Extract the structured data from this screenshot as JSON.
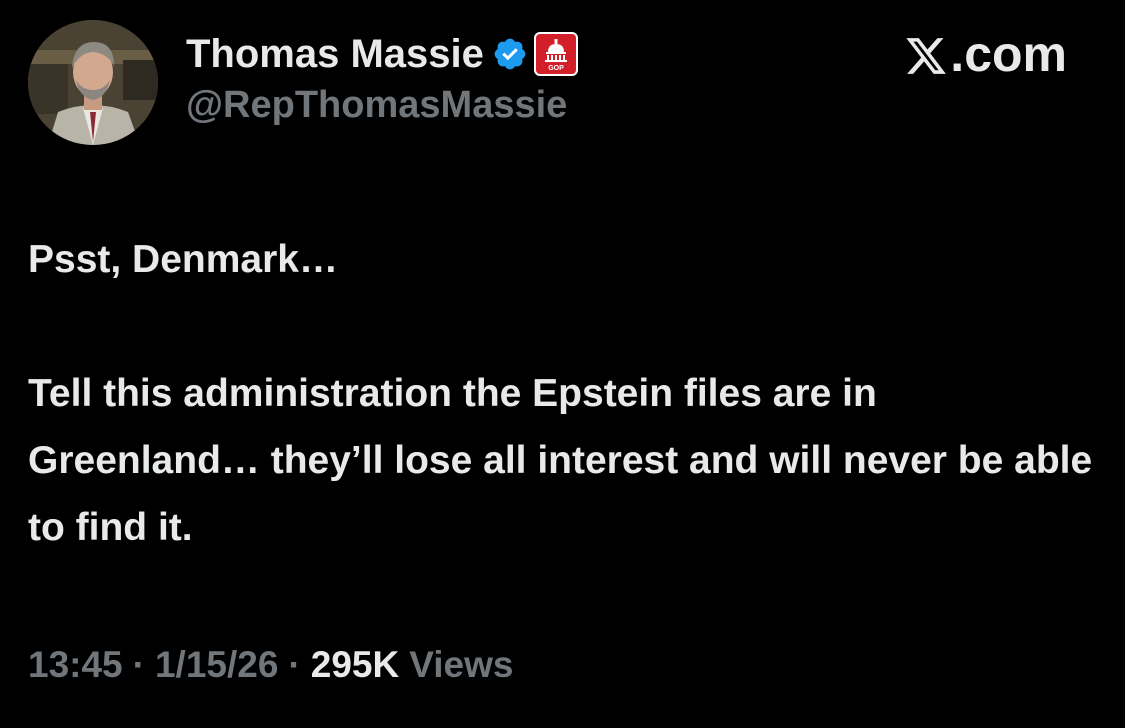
{
  "author": {
    "display_name": "Thomas Massie",
    "handle": "@RepThomasMassie",
    "verified_icon": "verified-badge-icon",
    "affiliation_icon": "capitol-badge-icon",
    "affiliation_text": "GOP",
    "avatar": "avatar-photo"
  },
  "brand": {
    "logo_icon": "x-logo-icon",
    "label": ".com"
  },
  "tweet": {
    "paragraphs": [
      "Psst, Denmark…",
      "Tell this administration the Epstein files are in Greenland… they’ll lose all interest and will never be able to find it."
    ]
  },
  "meta": {
    "time": "13:45",
    "separator": "·",
    "date": "1/15/26",
    "views_count": "295K",
    "views_label": "Views"
  },
  "colors": {
    "background": "#000000",
    "primary_text": "#e7e9ea",
    "secondary_text": "#71767b",
    "verified_blue": "#1d9bf0",
    "affiliation_red": "#d21f2a"
  }
}
